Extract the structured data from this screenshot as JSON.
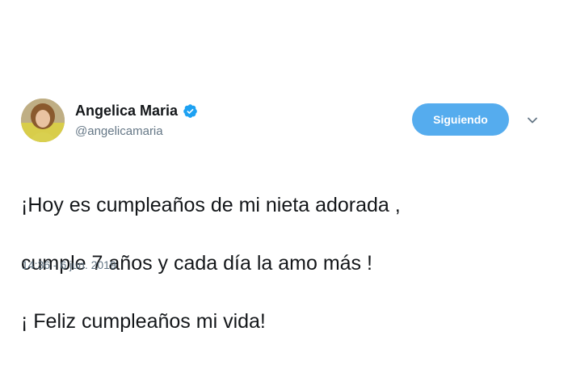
{
  "tweet": {
    "author": {
      "display_name": "Angelica Maria",
      "handle": "@angelicamaria",
      "verified": true
    },
    "follow_button_label": "Siguiendo",
    "text_lines": [
      "¡Hoy es cumpleaños de mi nieta adorada ,",
      "cumple 7 años y cada día la amo más !",
      "¡ Feliz cumpleaños mi vida!"
    ],
    "timestamp": "14:36 - 6 jun. 2019"
  },
  "colors": {
    "accent": "#55acee",
    "verified": "#1da1f2",
    "secondary_text": "#657786",
    "primary_text": "#14171a"
  },
  "icons": {
    "verified": "verified-badge-icon",
    "more": "chevron-down-icon"
  }
}
